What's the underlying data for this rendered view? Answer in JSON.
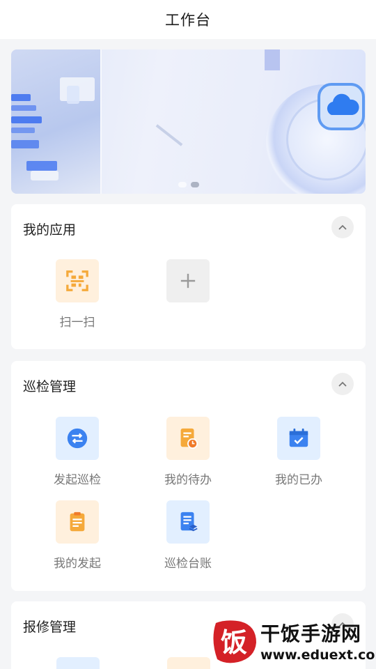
{
  "header": {
    "title": "工作台"
  },
  "banner": {
    "dots": 2,
    "active_index": 1
  },
  "sections": {
    "my_apps": {
      "title": "我的应用",
      "items": [
        {
          "label": "扫一扫",
          "icon": "scan-icon",
          "color": "#f5a93a"
        },
        {
          "label": "",
          "icon": "add-icon",
          "color": "#9a9a9a"
        }
      ]
    },
    "inspection": {
      "title": "巡检管理",
      "items": [
        {
          "label": "发起巡检",
          "icon": "switch-arrows-icon",
          "color": "#3b82f0"
        },
        {
          "label": "我的待办",
          "icon": "document-clock-icon",
          "color": "#f5a93a"
        },
        {
          "label": "我的已办",
          "icon": "calendar-check-icon",
          "color": "#3b82f0"
        },
        {
          "label": "我的发起",
          "icon": "clipboard-icon",
          "color": "#f5a93a"
        },
        {
          "label": "巡检台账",
          "icon": "ledger-icon",
          "color": "#3b82f0"
        }
      ]
    },
    "repair": {
      "title": "报修管理"
    }
  },
  "watermark": {
    "text": "干饭手游网",
    "url": "www.eduext.com",
    "logo_char": "饭",
    "brand_color": "#d42127"
  }
}
